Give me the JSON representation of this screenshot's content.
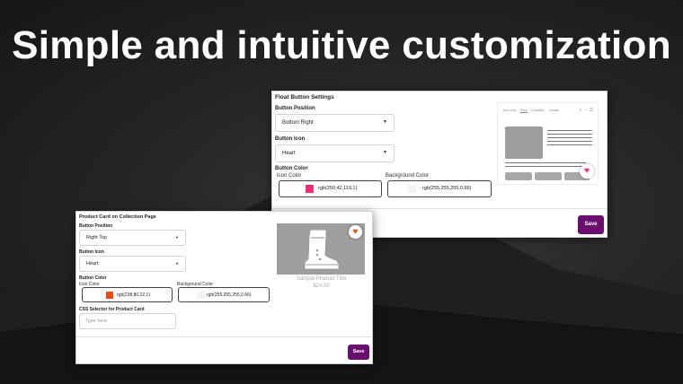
{
  "headline": "Simple and intuitive customization",
  "float_panel": {
    "title": "Float Button Settings",
    "position_label": "Button Position",
    "position_value": "Bottom Right",
    "icon_label": "Button Icon",
    "icon_value": "Heart",
    "color_label": "Button Color",
    "icon_color_label": "Icon Color",
    "icon_color_value": "rgb(250,42,119,1)",
    "icon_color_hex": "#fa2a77",
    "bg_color_label": "Background Color",
    "bg_color_value": "rgb(255,255,255,0.66)",
    "save_label": "Save",
    "preview": {
      "nav_items": [
        "Your shop",
        "Shop",
        "Collection",
        "Contact"
      ]
    }
  },
  "product_panel": {
    "title": "Product Card on Collection Page",
    "position_label": "Button Position",
    "position_value": "Right Top",
    "icon_label": "Button Icon",
    "icon_value": "Heart",
    "color_label": "Button Color",
    "icon_color_label": "Icon Color",
    "icon_color_value": "rgb(238,80,12,1)",
    "icon_color_hex": "#ee500c",
    "bg_color_label": "Background Color",
    "bg_color_value": "rgb(255,255,255,0.66)",
    "css_label": "CSS Selector for Product Card",
    "css_placeholder": "Type here",
    "save_label": "Save",
    "sample_title": "Sample Product Title",
    "sample_price": "$24.00"
  },
  "colors": {
    "accent": "#6a0f6f",
    "float_heart": "#fa2a77",
    "card_heart": "#ee500c"
  }
}
